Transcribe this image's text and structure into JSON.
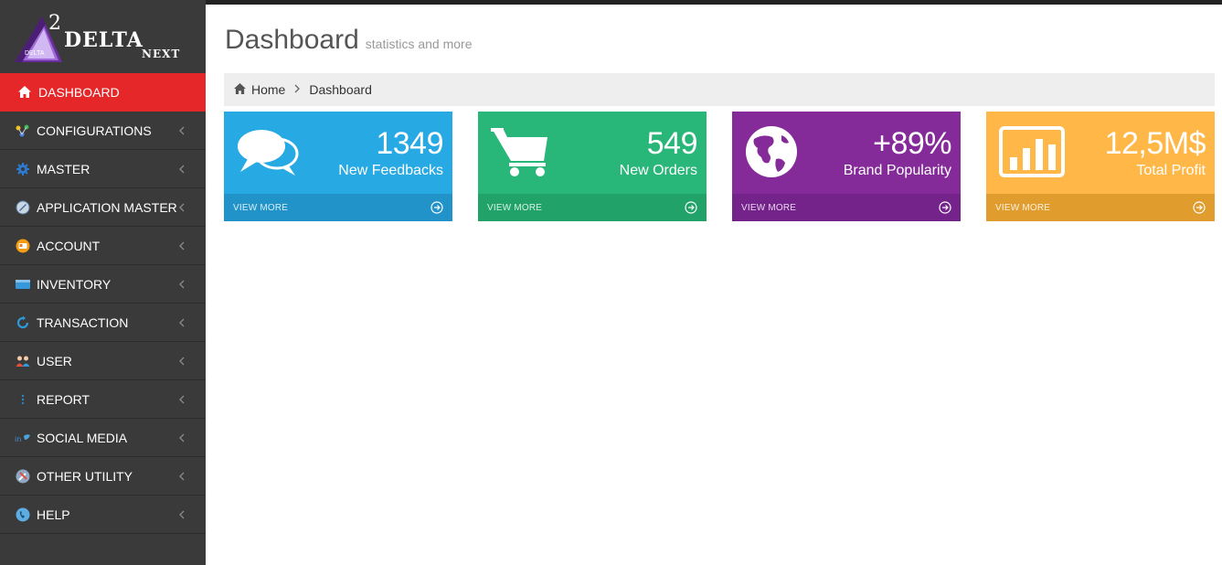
{
  "logo": {
    "superscript": "2",
    "brand": "DELTA",
    "tagline": "NEXT",
    "mini_text": "DELTA"
  },
  "sidebar": {
    "items": [
      {
        "label": "DASHBOARD",
        "icon": "home-icon",
        "active": true
      },
      {
        "label": "CONFIGURATIONS",
        "icon": "network-nodes-icon"
      },
      {
        "label": "MASTER",
        "icon": "gear-icon"
      },
      {
        "label": "APPLICATION MASTER",
        "icon": "app-settings-icon"
      },
      {
        "label": "ACCOUNT",
        "icon": "account-card-icon"
      },
      {
        "label": "INVENTORY",
        "icon": "inventory-box-icon"
      },
      {
        "label": "TRANSACTION",
        "icon": "transaction-loop-icon"
      },
      {
        "label": "USER",
        "icon": "users-group-icon"
      },
      {
        "label": "REPORT",
        "icon": "report-dots-icon"
      },
      {
        "label": "SOCIAL MEDIA",
        "icon": "social-media-icon"
      },
      {
        "label": "OTHER UTILITY",
        "icon": "tools-icon"
      },
      {
        "label": "HELP",
        "icon": "help-phone-icon"
      }
    ]
  },
  "header": {
    "title": "Dashboard",
    "subtitle": "statistics and more"
  },
  "breadcrumb": {
    "home": "Home",
    "current": "Dashboard"
  },
  "tiles": [
    {
      "value": "1349",
      "desc": "New Feedbacks",
      "more": "VIEW MORE",
      "icon": "comments-icon",
      "color": "#27a9e3"
    },
    {
      "value": "549",
      "desc": "New Orders",
      "more": "VIEW MORE",
      "icon": "shopping-cart-icon",
      "color": "#28b779"
    },
    {
      "value": "+89%",
      "desc": "Brand Popularity",
      "more": "VIEW MORE",
      "icon": "globe-icon",
      "color": "#852b99"
    },
    {
      "value": "12,5M$",
      "desc": "Total Profit",
      "more": "VIEW MORE",
      "icon": "bar-chart-icon",
      "color": "#ffb848"
    }
  ],
  "colors": {
    "sidebar_bg": "#3a3a3a",
    "active": "#e5272a",
    "breadcrumb_bg": "#eeeeee"
  }
}
